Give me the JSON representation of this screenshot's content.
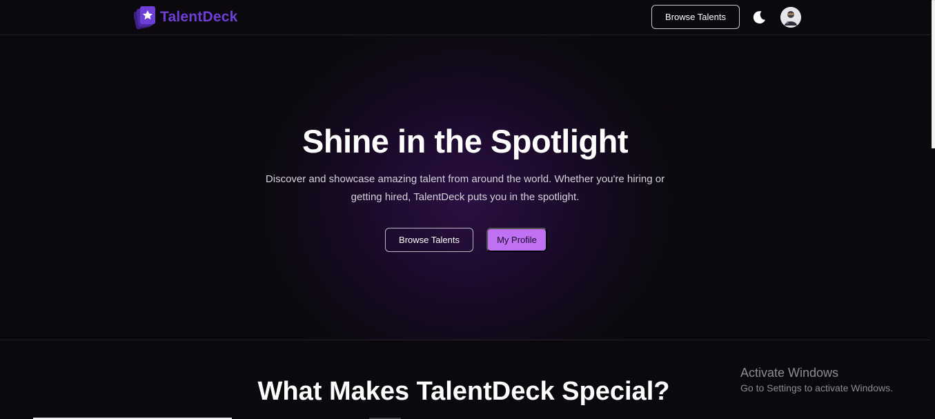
{
  "brand": {
    "name": "TalentDeck",
    "logo_icon": "cards-star-icon",
    "color": "#6d3fd6"
  },
  "navbar": {
    "browse_label": "Browse Talents",
    "theme_icon": "moon-icon",
    "avatar_icon": "user-avatar"
  },
  "hero": {
    "title": "Shine in the Spotlight",
    "subtitle": "Discover and showcase amazing talent from around the world. Whether you're hiring or getting hired, TalentDeck puts you in the spotlight.",
    "browse_label": "Browse Talents",
    "profile_label": "My Profile",
    "accent_color": "#c071f3"
  },
  "features": {
    "title": "What Makes TalentDeck Special?"
  },
  "watermark": {
    "title": "Activate Windows",
    "subtitle": "Go to Settings to activate Windows."
  }
}
